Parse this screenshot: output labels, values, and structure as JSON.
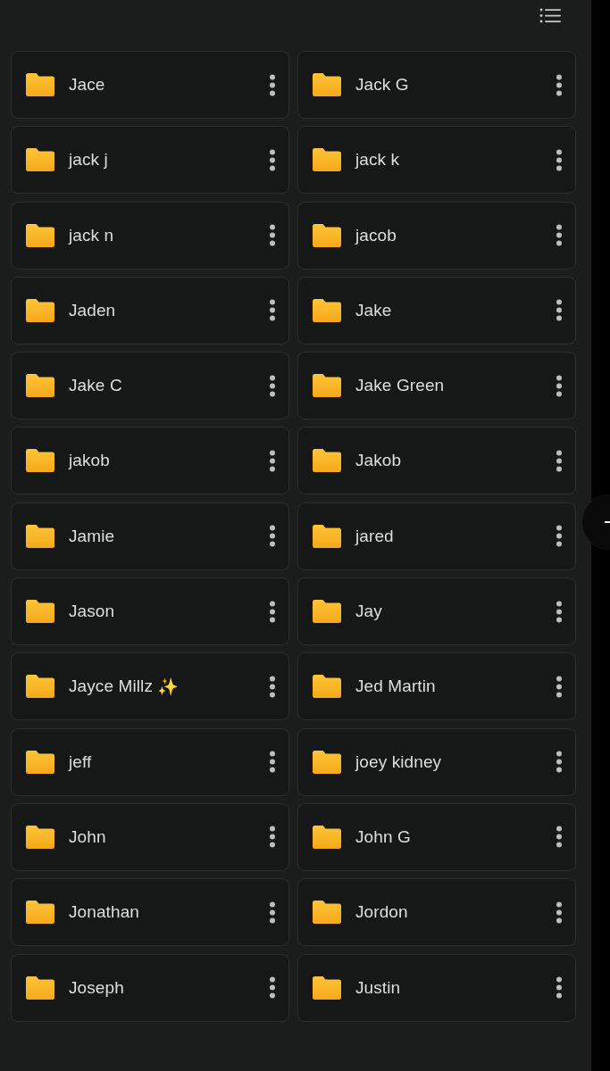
{
  "folders": [
    {
      "name": "Jace"
    },
    {
      "name": "Jack G"
    },
    {
      "name": "jack j"
    },
    {
      "name": "jack k"
    },
    {
      "name": "jack n"
    },
    {
      "name": "jacob"
    },
    {
      "name": "Jaden"
    },
    {
      "name": "Jake"
    },
    {
      "name": "Jake C"
    },
    {
      "name": "Jake Green"
    },
    {
      "name": "jakob"
    },
    {
      "name": "Jakob"
    },
    {
      "name": "Jamie"
    },
    {
      "name": "jared"
    },
    {
      "name": "Jason"
    },
    {
      "name": "Jay"
    },
    {
      "name": "Jayce Millz",
      "emoji": "✨"
    },
    {
      "name": "Jed Martin"
    },
    {
      "name": "jeff"
    },
    {
      "name": "joey kidney"
    },
    {
      "name": "John"
    },
    {
      "name": "John G"
    },
    {
      "name": "Jonathan"
    },
    {
      "name": "Jordon"
    },
    {
      "name": "Joseph"
    },
    {
      "name": "Justin"
    }
  ]
}
